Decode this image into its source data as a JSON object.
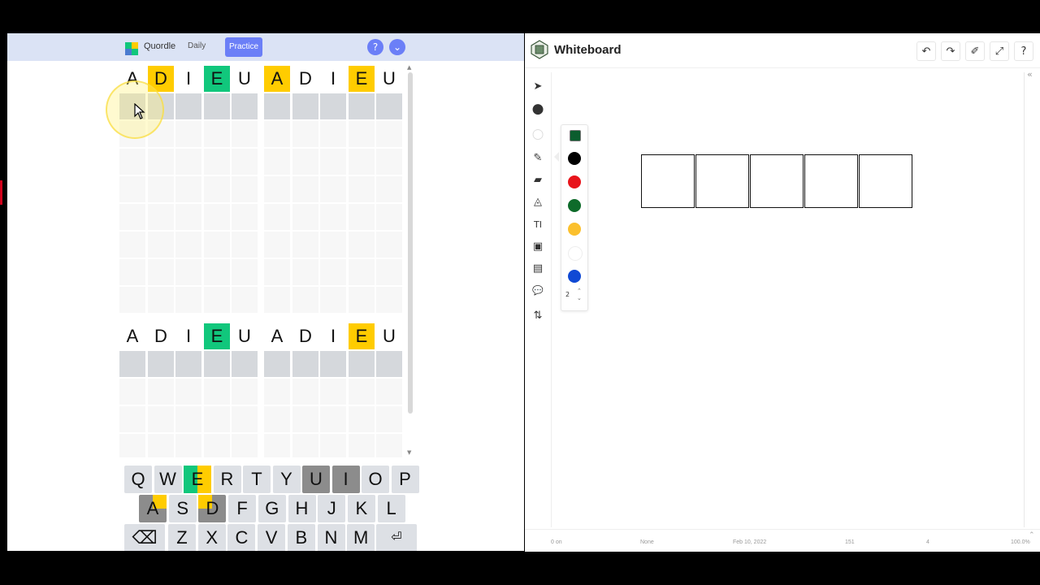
{
  "quordle": {
    "title": "Quordle",
    "tabs": {
      "daily": "Daily",
      "practice": "Practice"
    },
    "icons": {
      "logo": "quordle-logo",
      "help": "help-icon",
      "menu": "chevron-down-icon"
    },
    "boards": [
      {
        "guess": [
          [
            "A",
            "plain"
          ],
          [
            "D",
            "yellow"
          ],
          [
            "I",
            "plain"
          ],
          [
            "E",
            "green"
          ],
          [
            "U",
            "plain"
          ]
        ]
      },
      {
        "guess": [
          [
            "A",
            "yellow"
          ],
          [
            "D",
            "plain"
          ],
          [
            "I",
            "plain"
          ],
          [
            "E",
            "yellow"
          ],
          [
            "U",
            "plain"
          ]
        ]
      },
      {
        "guess": [
          [
            "A",
            "plain"
          ],
          [
            "D",
            "plain"
          ],
          [
            "I",
            "plain"
          ],
          [
            "E",
            "green"
          ],
          [
            "U",
            "plain"
          ]
        ]
      },
      {
        "guess": [
          [
            "A",
            "plain"
          ],
          [
            "D",
            "plain"
          ],
          [
            "I",
            "plain"
          ],
          [
            "E",
            "yellow"
          ],
          [
            "U",
            "plain"
          ]
        ]
      }
    ],
    "keyboard": {
      "row1": [
        "Q",
        "W",
        "E",
        "R",
        "T",
        "Y",
        "U",
        "I",
        "O",
        "P"
      ],
      "row2": [
        "A",
        "S",
        "D",
        "F",
        "G",
        "H",
        "J",
        "K",
        "L"
      ],
      "row3_letters": [
        "Z",
        "X",
        "C",
        "V",
        "B",
        "N",
        "M"
      ],
      "backspace_icon": "backspace-icon",
      "enter_icon": "enter-icon",
      "backspace_glyph": "⌫",
      "enter_glyph": "⏎"
    }
  },
  "whiteboard": {
    "title": "Whiteboard",
    "header_buttons": [
      {
        "name": "undo-icon",
        "glyph": "↶"
      },
      {
        "name": "redo-icon",
        "glyph": "↷"
      },
      {
        "name": "brush-icon",
        "glyph": "✐"
      },
      {
        "name": "fullscreen-icon",
        "glyph": "⤢"
      },
      {
        "name": "help-icon",
        "glyph": "?"
      }
    ],
    "tools": [
      {
        "name": "select-icon",
        "glyph": "➤"
      },
      {
        "name": "fill-color-icon",
        "glyph": "●"
      },
      {
        "name": "stroke-white-icon",
        "glyph": "○"
      },
      {
        "name": "pencil-icon",
        "glyph": "✎"
      },
      {
        "name": "eraser-icon",
        "glyph": "▰"
      },
      {
        "name": "shapes-icon",
        "glyph": "◬"
      },
      {
        "name": "text-icon",
        "glyph": "TI"
      },
      {
        "name": "image-icon",
        "glyph": "▣"
      },
      {
        "name": "document-icon",
        "glyph": "▤"
      },
      {
        "name": "chat-icon",
        "glyph": "💬"
      },
      {
        "name": "sort-icon",
        "glyph": "⇅"
      }
    ],
    "palette": {
      "colors": [
        "#0b5d2e",
        "#000000",
        "#e8141b",
        "#0e6b2a",
        "#fbc02d",
        "#ffffff",
        "#1049d4"
      ],
      "stroke_size": "2"
    },
    "footer": [
      "0  on",
      "None",
      "Feb 10, 2022",
      "151",
      "4",
      "100.0%"
    ]
  }
}
